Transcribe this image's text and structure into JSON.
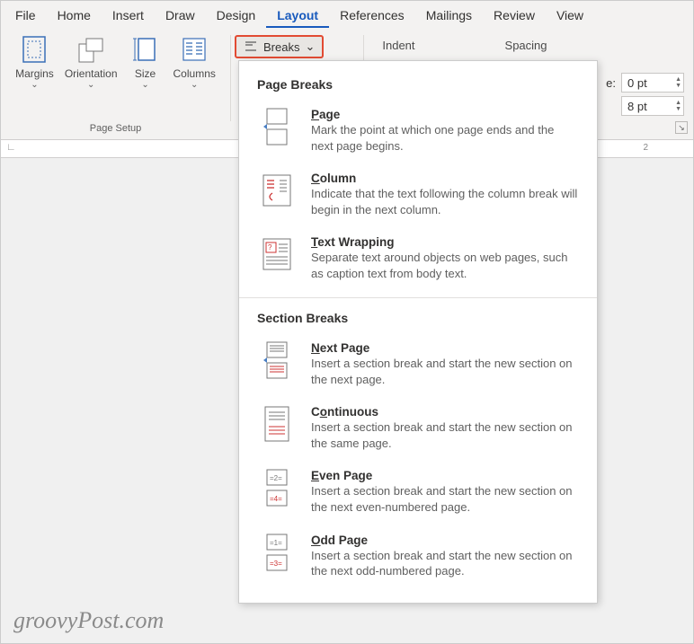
{
  "tabs": [
    "File",
    "Home",
    "Insert",
    "Draw",
    "Design",
    "Layout",
    "References",
    "Mailings",
    "Review",
    "View"
  ],
  "active_tab": "Layout",
  "ribbon": {
    "margins": "Margins",
    "orientation": "Orientation",
    "size": "Size",
    "columns": "Columns",
    "page_setup": "Page Setup",
    "breaks": "Breaks",
    "indent": "Indent",
    "spacing": "Spacing",
    "before_label": "e:",
    "before_val": "0 pt",
    "after_val": "8 pt"
  },
  "ruler_mark": "2",
  "dropdown": {
    "h1": "Page Breaks",
    "h2": "Section Breaks",
    "items1": [
      {
        "title_pre": "P",
        "title_rest": "age",
        "desc": "Mark the point at which one page ends and the next page begins."
      },
      {
        "title_pre": "C",
        "title_rest": "olumn",
        "desc": "Indicate that the text following the column break will begin in the next column."
      },
      {
        "title_pre": "T",
        "title_rest": "ext Wrapping",
        "desc": "Separate text around objects on web pages, such as caption text from body text."
      }
    ],
    "items2": [
      {
        "title_pre": "N",
        "title_rest": "ext Page",
        "desc": "Insert a section break and start the new section on the next page."
      },
      {
        "title_pre": "",
        "title_rest": "Continuous",
        "desc": "Insert a section break and start the new section on the same page.",
        "ulchar": "o",
        "ulidx": 1
      },
      {
        "title_pre": "E",
        "title_rest": "ven Page",
        "desc": "Insert a section break and start the new section on the next even-numbered page."
      },
      {
        "title_pre": "O",
        "title_rest": "dd Page",
        "desc": "Insert a section break and start the new section on the next odd-numbered page."
      }
    ]
  },
  "watermark": "groovyPost.com"
}
